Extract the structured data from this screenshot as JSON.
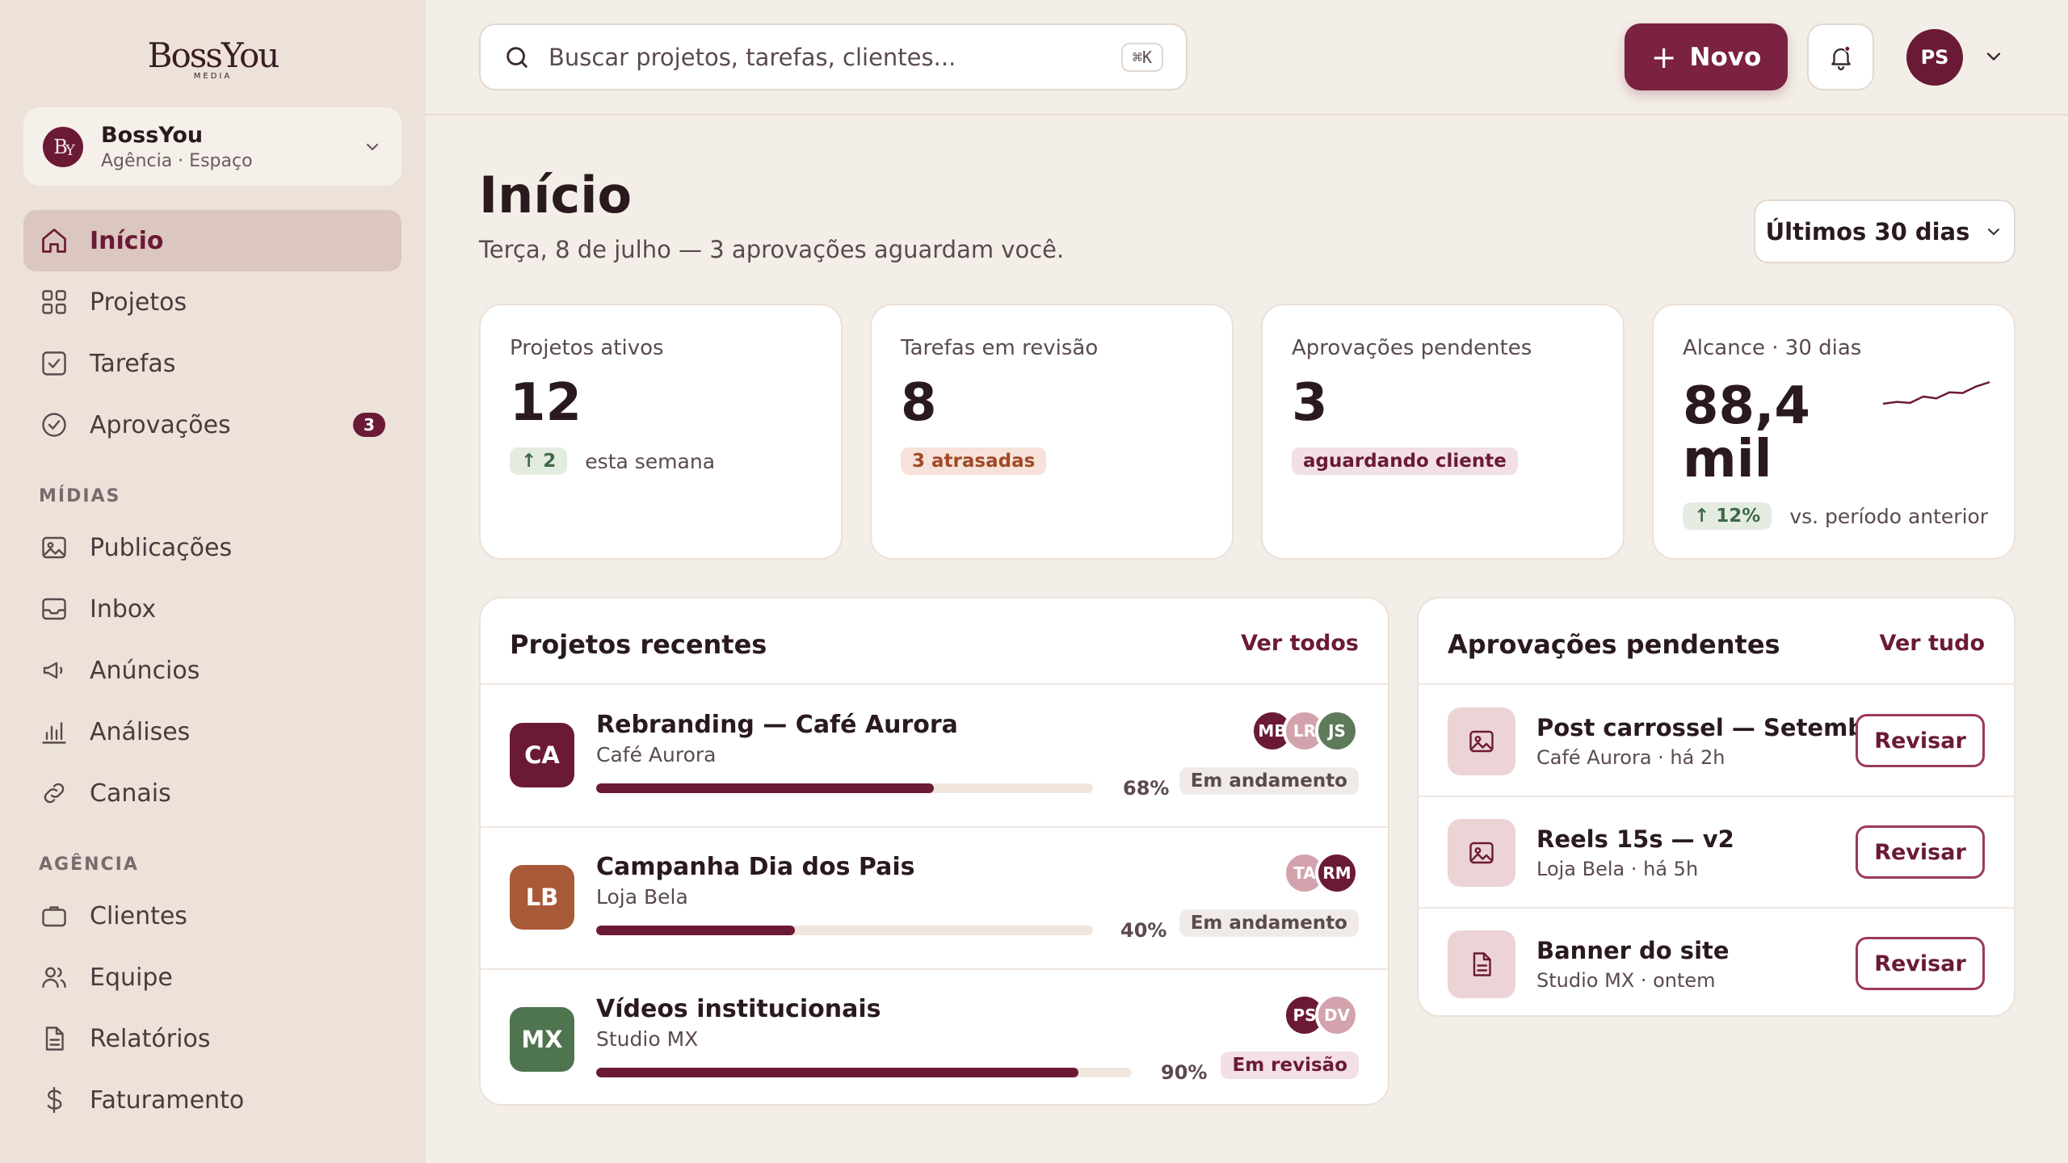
{
  "brand": {
    "name": "BossYou",
    "tagline": "MEDIA"
  },
  "workspace": {
    "initials": "BY",
    "name": "BossYou",
    "subtitle": "Agência · Espaço"
  },
  "nav": {
    "main": [
      {
        "label": "Início",
        "icon": "home-icon",
        "active": true
      },
      {
        "label": "Projetos",
        "icon": "grid-icon"
      },
      {
        "label": "Tarefas",
        "icon": "checkbox-icon"
      },
      {
        "label": "Aprovações",
        "icon": "check-circle-icon",
        "badge": "3"
      }
    ],
    "media_label": "MÍDIAS",
    "media": [
      {
        "label": "Publicações",
        "icon": "image-icon"
      },
      {
        "label": "Inbox",
        "icon": "inbox-icon"
      },
      {
        "label": "Anúncios",
        "icon": "megaphone-icon"
      },
      {
        "label": "Análises",
        "icon": "bar-chart-icon"
      },
      {
        "label": "Canais",
        "icon": "link-icon"
      }
    ],
    "agency_label": "AGÊNCIA",
    "agency": [
      {
        "label": "Clientes",
        "icon": "briefcase-icon"
      },
      {
        "label": "Equipe",
        "icon": "users-icon"
      },
      {
        "label": "Relatórios",
        "icon": "file-icon"
      },
      {
        "label": "Faturamento",
        "icon": "dollar-icon"
      }
    ]
  },
  "topbar": {
    "search_placeholder": "Buscar projetos, tarefas, clientes...",
    "shortcut": "⌘K",
    "new_label": "Novo",
    "user_initials": "PS"
  },
  "page": {
    "title": "Início",
    "subtitle": "Terça, 8 de julho — 3 aprovações aguardam você.",
    "range_label": "Últimos 30 dias"
  },
  "stats": [
    {
      "label": "Projetos ativos",
      "value": "12",
      "pill": "2",
      "note": "esta semana"
    },
    {
      "label": "Tarefas em revisão",
      "value": "8",
      "pill": "3 atrasadas"
    },
    {
      "label": "Aprovações pendentes",
      "value": "3",
      "pill": "aguardando cliente"
    },
    {
      "label": "Alcance · 30 dias",
      "value_line1": "88,4",
      "value_line2": "mil",
      "pill": "12%",
      "note": "vs. período anterior",
      "sparkline": [
        0.3,
        0.35,
        0.32,
        0.5,
        0.45,
        0.62,
        0.6,
        0.78,
        0.9
      ]
    }
  ],
  "projects": {
    "title": "Projetos recentes",
    "link": "Ver todos",
    "items": [
      {
        "initials": "CA",
        "color": "#6b1a36",
        "name": "Rebranding — Café Aurora",
        "client": "Café Aurora",
        "progress": 68,
        "progress_label": "68%",
        "status": "Em andamento",
        "members": [
          {
            "i": "MB",
            "c": "#6b1a36"
          },
          {
            "i": "LR",
            "c": "#d2a3ac"
          },
          {
            "i": "JS",
            "c": "#5e7a5a"
          }
        ]
      },
      {
        "initials": "LB",
        "color": "#a85a38",
        "name": "Campanha Dia dos Pais",
        "client": "Loja Bela",
        "progress": 40,
        "progress_label": "40%",
        "status": "Em andamento",
        "members": [
          {
            "i": "TA",
            "c": "#d2a3ac"
          },
          {
            "i": "RM",
            "c": "#6b1a36"
          }
        ]
      },
      {
        "initials": "MX",
        "color": "#4e7450",
        "name": "Vídeos institucionais",
        "client": "Studio MX",
        "progress": 90,
        "progress_label": "90%",
        "status": "Em revisão",
        "members": [
          {
            "i": "PS",
            "c": "#6b1a36"
          },
          {
            "i": "DV",
            "c": "#d2a3ac"
          }
        ]
      }
    ]
  },
  "approvals": {
    "title": "Aprovações pendentes",
    "link": "Ver tudo",
    "items": [
      {
        "icon": "image-icon",
        "name": "Post carrossel — Setembro",
        "meta": "Café Aurora · há 2h",
        "action": "Revisar"
      },
      {
        "icon": "image-icon",
        "name": "Reels 15s — v2",
        "meta": "Loja Bela · há 5h",
        "action": "Revisar"
      },
      {
        "icon": "file-icon",
        "name": "Banner do site",
        "meta": "Studio MX · ontem",
        "action": "Revisar"
      }
    ]
  },
  "colors": {
    "accent": "#6b1a36",
    "sidebar": "#ece2da",
    "background": "#f4eee8",
    "positive": "#3e6a46"
  }
}
